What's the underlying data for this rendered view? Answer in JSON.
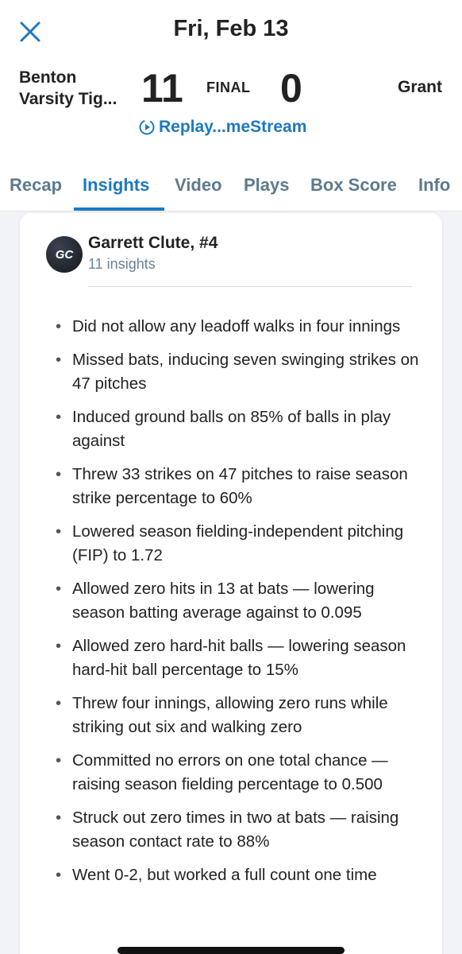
{
  "header": {
    "date": "Fri, Feb 13"
  },
  "scoreboard": {
    "home_team": "Benton Varsity Tig...",
    "home_team_line1": "Benton",
    "home_team_line2": "Varsity Tig...",
    "home_score": "11",
    "status": "FINAL",
    "away_score": "0",
    "away_team": "Grant",
    "replay_label": "Replay...meStream"
  },
  "tabs": [
    {
      "label": "Recap",
      "active": false
    },
    {
      "label": "Insights",
      "active": true
    },
    {
      "label": "Video",
      "active": false
    },
    {
      "label": "Plays",
      "active": false
    },
    {
      "label": "Box Score",
      "active": false
    },
    {
      "label": "Info",
      "active": false
    }
  ],
  "player": {
    "initials": "GC",
    "name": "Garrett Clute, #4",
    "insight_count": "11 insights"
  },
  "insights": [
    "Did not allow any leadoff walks in four innings",
    "Missed bats, inducing seven swinging strikes on 47 pitches",
    "Induced ground balls on 85% of balls in play against",
    "Threw 33 strikes on 47 pitches to raise season strike percentage to 60%",
    "Lowered season fielding-independent pitching (FIP) to 1.72",
    "Allowed zero hits in 13 at bats — lowering season batting average against to 0.095",
    "Allowed zero hard-hit balls — lowering season hard-hit ball percentage to 15%",
    "Threw four innings, allowing zero runs while striking out six and walking zero",
    "Committed no errors on one total chance — raising season fielding percentage to 0.500",
    "Struck out zero times in two at bats — raising season contact rate to 88%",
    "Went 0-2, but worked a full count one time"
  ],
  "colors": {
    "accent": "#1d78c1",
    "tab_inactive": "#5d7a8e",
    "background": "#f2f3f6"
  },
  "icons": {
    "close": "close-icon",
    "replay": "replay-icon"
  }
}
